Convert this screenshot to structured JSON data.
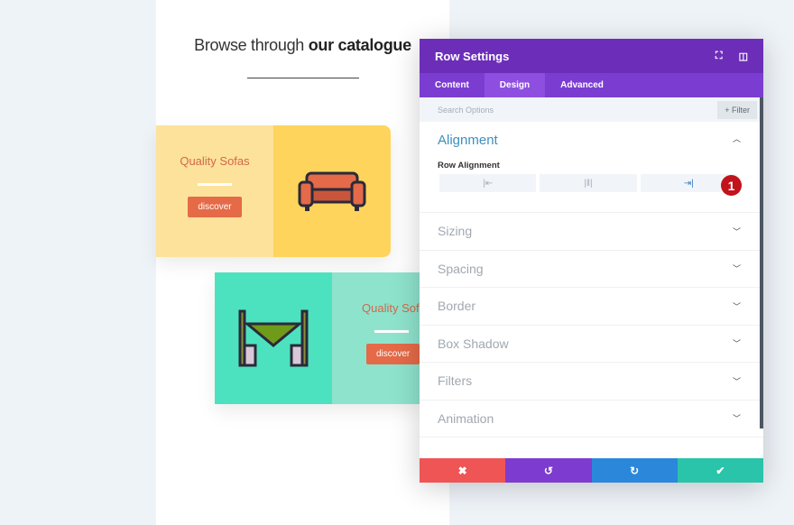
{
  "page": {
    "heading_normal": "Browse through ",
    "heading_bold": "our catalogue"
  },
  "cards": [
    {
      "title": "Quality Sofas",
      "button": "discover",
      "icon": "sofa-icon",
      "colors": {
        "text_side": "#fde29b",
        "icon_side": "#fed45c"
      }
    },
    {
      "title": "Quality Sofas",
      "button": "discover",
      "icon": "dining-table-icon",
      "colors": {
        "text_side": "#8ee3cd",
        "icon_side": "#4de2bf"
      }
    }
  ],
  "modal": {
    "title": "Row Settings",
    "tabs": [
      {
        "label": "Content"
      },
      {
        "label": "Design",
        "active": true
      },
      {
        "label": "Advanced"
      }
    ],
    "search_placeholder": "Search Options",
    "filter_label": "+ Filter",
    "alignment": {
      "title": "Alignment",
      "field_label": "Row Alignment",
      "options": [
        "left",
        "center",
        "right"
      ],
      "selected": "right",
      "step_badge": "1"
    },
    "sections": [
      {
        "label": "Sizing"
      },
      {
        "label": "Spacing"
      },
      {
        "label": "Border"
      },
      {
        "label": "Box Shadow"
      },
      {
        "label": "Filters"
      },
      {
        "label": "Animation"
      }
    ],
    "footer": {
      "colors": {
        "cancel": "#ef5555",
        "undo": "#7e3bd0",
        "redo": "#2b87da",
        "save": "#29c4a9"
      }
    }
  }
}
